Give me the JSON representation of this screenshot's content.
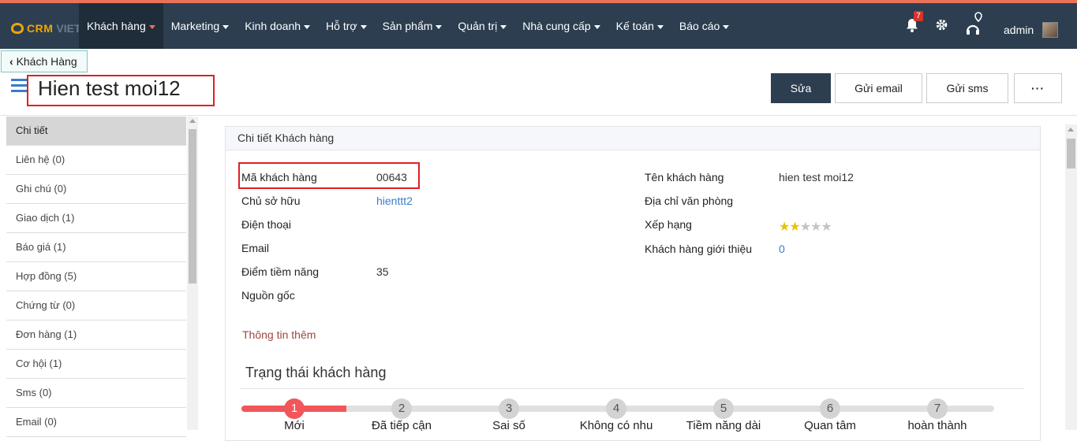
{
  "brand": {
    "part1": "CRM",
    "part2": "VIET"
  },
  "nav": [
    {
      "label": "Khách hàng"
    },
    {
      "label": "Marketing"
    },
    {
      "label": "Kinh doanh"
    },
    {
      "label": "Hỗ trợ"
    },
    {
      "label": "Sản phẩm"
    },
    {
      "label": "Quản trị"
    },
    {
      "label": "Nhà cung cấp"
    },
    {
      "label": "Kế toán"
    },
    {
      "label": "Báo cáo"
    }
  ],
  "topbar": {
    "notification_count": "7",
    "user": "admin"
  },
  "header": {
    "back_label": "Khách Hàng",
    "title": "Hien test moi12",
    "actions": {
      "edit": "Sửa",
      "email": "Gửi email",
      "sms": "Gửi sms",
      "more": "···"
    }
  },
  "sidebar": {
    "items": [
      {
        "label": "Chi tiết"
      },
      {
        "label": "Liên hệ (0)"
      },
      {
        "label": "Ghi chú (0)"
      },
      {
        "label": "Giao dịch (1)"
      },
      {
        "label": "Báo giá (1)"
      },
      {
        "label": "Hợp đồng (5)"
      },
      {
        "label": "Chứng từ (0)"
      },
      {
        "label": "Đơn hàng (1)"
      },
      {
        "label": "Cơ hội (1)"
      },
      {
        "label": "Sms (0)"
      },
      {
        "label": "Email (0)"
      }
    ]
  },
  "panel": {
    "title": "Chi tiết Khách hàng",
    "left_fields": [
      {
        "label": "Mã khách hàng",
        "value": "00643"
      },
      {
        "label": "Chủ sở hữu",
        "value": "hienttt2"
      },
      {
        "label": "Điện thoại",
        "value": ""
      },
      {
        "label": "Email",
        "value": ""
      },
      {
        "label": "Điểm tiềm năng",
        "value": "35"
      },
      {
        "label": "Nguồn gốc",
        "value": ""
      }
    ],
    "right_fields": [
      {
        "label": "Tên khách hàng",
        "value": "hien test moi12"
      },
      {
        "label": "Địa chỉ văn phòng",
        "value": ""
      },
      {
        "label": "Xếp hạng",
        "value": ""
      },
      {
        "label": "Khách hàng giới thiệu",
        "value": "0"
      }
    ],
    "rating": {
      "value": 2,
      "max": 5
    },
    "more_info": "Thông tin thêm",
    "status_title": "Trạng thái khách hàng",
    "status_current": 1,
    "status_steps": [
      {
        "num": "1",
        "label": "Mới"
      },
      {
        "num": "2",
        "label": "Đã tiếp cận"
      },
      {
        "num": "3",
        "label": "Sai số"
      },
      {
        "num": "4",
        "label": "Không có nhu"
      },
      {
        "num": "5",
        "label": "Tiềm năng dài"
      },
      {
        "num": "6",
        "label": "Quan tâm"
      },
      {
        "num": "7",
        "label": "hoàn thành"
      }
    ]
  },
  "colors": {
    "topbar": "#2c3e50",
    "accent": "#e9735a",
    "link": "#3a7cc9",
    "step_active": "#f0565a",
    "highlight_box": "#e02020"
  }
}
